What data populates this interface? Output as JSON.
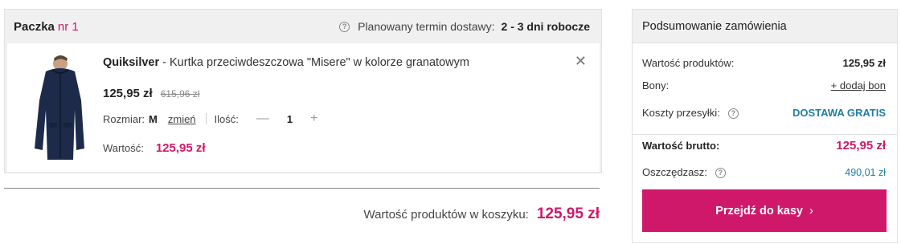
{
  "package": {
    "title": "Paczka",
    "number": "nr 1",
    "delivery_label": "Planowany termin dostawy:",
    "delivery_value": "2 - 3 dni robocze"
  },
  "product": {
    "brand": "Quiksilver",
    "description": " - Kurtka przeciwdeszczowa \"Misere\" w kolorze granatowym",
    "price": "125,95 zł",
    "old_price": "615,96 zł",
    "size_label": "Rozmiar:",
    "size_value": "M",
    "change_label": "zmień",
    "qty_label": "Ilość:",
    "qty_minus": "—",
    "qty_value": "1",
    "qty_plus": "+",
    "value_label": "Wartość:",
    "value_amount": "125,95 zł",
    "remove_icon": "close-icon",
    "image_icon": "jacket-photo",
    "jacket_color": "#1d2a4a"
  },
  "cart_total": {
    "label": "Wartość produktów w koszyku:",
    "amount": "125,95 zł"
  },
  "summary": {
    "title": "Podsumowanie zamówienia",
    "products_value_label": "Wartość produktów:",
    "products_value": "125,95 zł",
    "vouchers_label": "Bony:",
    "vouchers_link": "+ dodaj bon",
    "shipping_label": "Koszty przesyłki:",
    "shipping_value": "DOSTAWA GRATIS",
    "gross_label": "Wartość brutto:",
    "gross_value": "125,95 zł",
    "savings_label": "Oszczędzasz:",
    "savings_value": "490,01 zł",
    "checkout_label": "Przejdź do kasy",
    "checkout_chevron": "›"
  },
  "colors": {
    "accent": "#d0186a",
    "link_blue": "#1f7ea1",
    "header_bg": "#f0f0f0"
  }
}
